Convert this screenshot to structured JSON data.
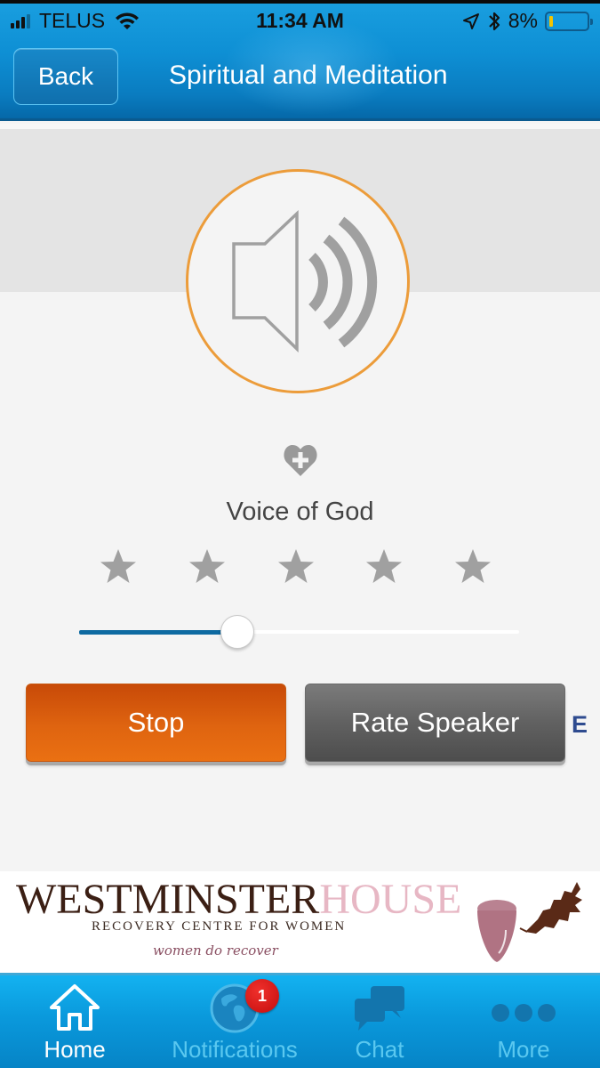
{
  "status_bar": {
    "carrier": "TELUS",
    "time": "11:34 AM",
    "battery_percent": "8%",
    "signal_bars_active": 3,
    "signal_bars_total": 4
  },
  "header": {
    "back_label": "Back",
    "title": "Spiritual and Meditation"
  },
  "player": {
    "speaker_icon": "speaker-volume-icon",
    "favorite_icon": "heart-plus-icon",
    "track_title": "Voice of God",
    "rating": {
      "filled": 0,
      "total": 5
    },
    "progress_fraction": 0.36,
    "colors": {
      "circle_border": "#ec9c3a",
      "icon_gray": "#a0a0a0",
      "slider_fill": "#0e6aa1"
    }
  },
  "buttons": {
    "stop_label": "Stop",
    "rate_label": "Rate Speaker",
    "clipped_label": "E"
  },
  "banner": {
    "title_part1": "WESTMINSTER",
    "title_part2": "HOUSE",
    "subtitle": "RECOVERY CENTRE FOR WOMEN",
    "tagline": "women do recover"
  },
  "tabbar": {
    "tabs": [
      {
        "label": "Home",
        "icon": "home-icon",
        "active": true
      },
      {
        "label": "Notifications",
        "icon": "globe-icon",
        "active": false,
        "badge": "1"
      },
      {
        "label": "Chat",
        "icon": "chat-bubbles-icon",
        "active": false
      },
      {
        "label": "More",
        "icon": "more-dots-icon",
        "active": false
      }
    ]
  }
}
